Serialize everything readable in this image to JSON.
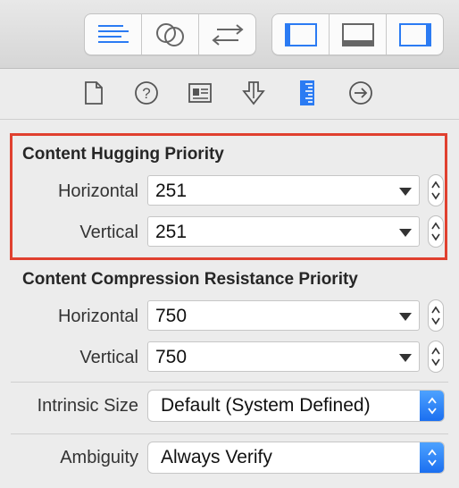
{
  "toolbar": {
    "editor_group": [
      "standard-editor-icon",
      "assistant-editor-icon",
      "version-editor-icon"
    ],
    "view_group": [
      "navigator-toggle-icon",
      "debug-area-toggle-icon",
      "utilities-toggle-icon"
    ]
  },
  "inspector_tabs": [
    "file-inspector-icon",
    "quick-help-icon",
    "identity-inspector-icon",
    "attributes-inspector-icon",
    "size-inspector-icon",
    "connections-inspector-icon"
  ],
  "selected_tab": "size-inspector-icon",
  "accent_color": "#1b6ff0",
  "highlight_color": "#e0402f",
  "hugging": {
    "title": "Content Hugging Priority",
    "horizontal_label": "Horizontal",
    "horizontal_value": "251",
    "vertical_label": "Vertical",
    "vertical_value": "251"
  },
  "compression": {
    "title": "Content Compression Resistance Priority",
    "horizontal_label": "Horizontal",
    "horizontal_value": "750",
    "vertical_label": "Vertical",
    "vertical_value": "750"
  },
  "intrinsic": {
    "label": "Intrinsic Size",
    "value": "Default (System Defined)"
  },
  "ambiguity": {
    "label": "Ambiguity",
    "value": "Always Verify"
  }
}
